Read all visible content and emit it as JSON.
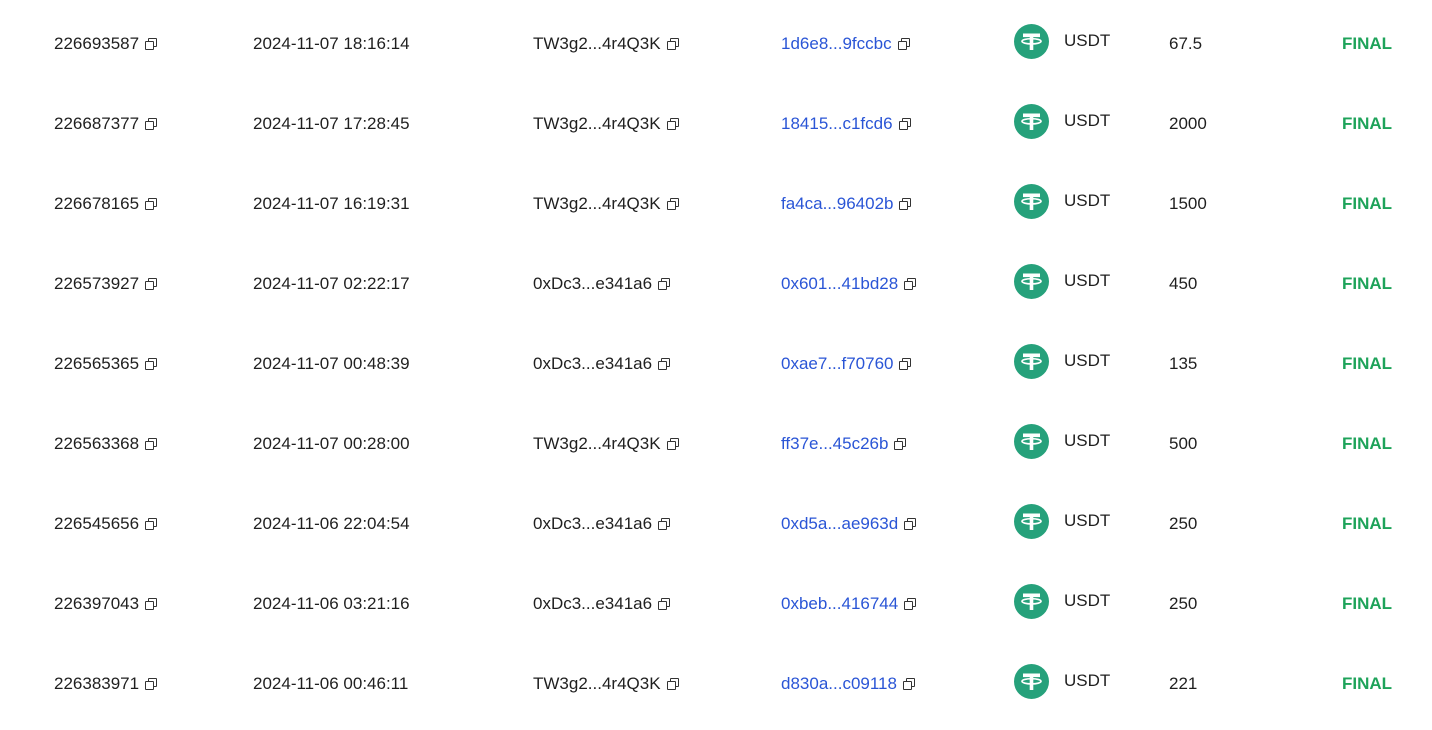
{
  "accent_colors": {
    "link": "#2a55d6",
    "status_final": "#1ea35a",
    "usdt_brand": "#26a17b"
  },
  "icons": {
    "copy": "copy-icon",
    "coin": "tether-usdt-icon"
  },
  "rows": [
    {
      "id": "226693587",
      "time": "2024-11-07 18:16:14",
      "address": "TW3g2...4r4Q3K",
      "hash": "1d6e8...9fccbc",
      "coin": "USDT",
      "amount": "67.5",
      "status": "FINAL"
    },
    {
      "id": "226687377",
      "time": "2024-11-07 17:28:45",
      "address": "TW3g2...4r4Q3K",
      "hash": "18415...c1fcd6",
      "coin": "USDT",
      "amount": "2000",
      "status": "FINAL"
    },
    {
      "id": "226678165",
      "time": "2024-11-07 16:19:31",
      "address": "TW3g2...4r4Q3K",
      "hash": "fa4ca...96402b",
      "coin": "USDT",
      "amount": "1500",
      "status": "FINAL"
    },
    {
      "id": "226573927",
      "time": "2024-11-07 02:22:17",
      "address": "0xDc3...e341a6",
      "hash": "0x601...41bd28",
      "coin": "USDT",
      "amount": "450",
      "status": "FINAL"
    },
    {
      "id": "226565365",
      "time": "2024-11-07 00:48:39",
      "address": "0xDc3...e341a6",
      "hash": "0xae7...f70760",
      "coin": "USDT",
      "amount": "135",
      "status": "FINAL"
    },
    {
      "id": "226563368",
      "time": "2024-11-07 00:28:00",
      "address": "TW3g2...4r4Q3K",
      "hash": "ff37e...45c26b",
      "coin": "USDT",
      "amount": "500",
      "status": "FINAL"
    },
    {
      "id": "226545656",
      "time": "2024-11-06 22:04:54",
      "address": "0xDc3...e341a6",
      "hash": "0xd5a...ae963d",
      "coin": "USDT",
      "amount": "250",
      "status": "FINAL"
    },
    {
      "id": "226397043",
      "time": "2024-11-06 03:21:16",
      "address": "0xDc3...e341a6",
      "hash": "0xbeb...416744",
      "coin": "USDT",
      "amount": "250",
      "status": "FINAL"
    },
    {
      "id": "226383971",
      "time": "2024-11-06 00:46:11",
      "address": "TW3g2...4r4Q3K",
      "hash": "d830a...c09118",
      "coin": "USDT",
      "amount": "221",
      "status": "FINAL"
    }
  ]
}
